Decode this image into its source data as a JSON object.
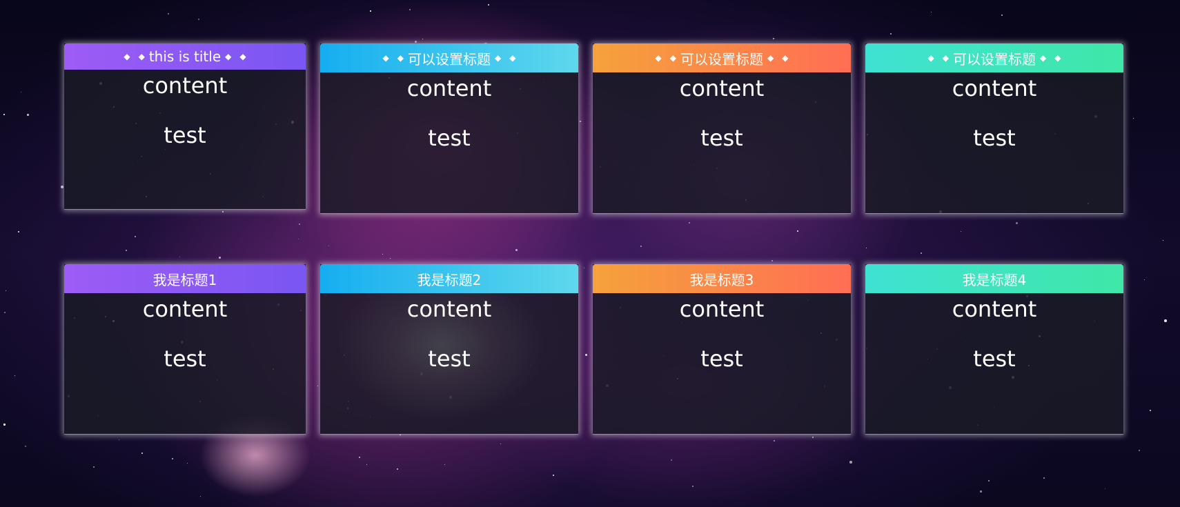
{
  "top_row": [
    {
      "title": "this is title",
      "color": "purple",
      "content": "content",
      "text": "test"
    },
    {
      "title": "可以设置标题",
      "color": "blue",
      "content": "content",
      "text": "test"
    },
    {
      "title": "可以设置标题",
      "color": "orange",
      "content": "content",
      "text": "test"
    },
    {
      "title": "可以设置标题",
      "color": "green",
      "content": "content",
      "text": "test"
    }
  ],
  "bottom_row": [
    {
      "title": "我是标题1",
      "color": "purple",
      "content": "content",
      "text": "test"
    },
    {
      "title": "我是标题2",
      "color": "blue",
      "content": "content",
      "text": "test"
    },
    {
      "title": "我是标题3",
      "color": "orange",
      "content": "content",
      "text": "test"
    },
    {
      "title": "我是标题4",
      "color": "green",
      "content": "content",
      "text": "test"
    }
  ],
  "decoration": {
    "diamond": "◆"
  },
  "colors": {
    "purple": [
      "#9d5cf5",
      "#7a56f2"
    ],
    "blue": [
      "#16aef0",
      "#5ed8ec"
    ],
    "orange": [
      "#f5a23c",
      "#ff6e54"
    ],
    "green": [
      "#3fe2d2",
      "#3fe7a8"
    ]
  }
}
